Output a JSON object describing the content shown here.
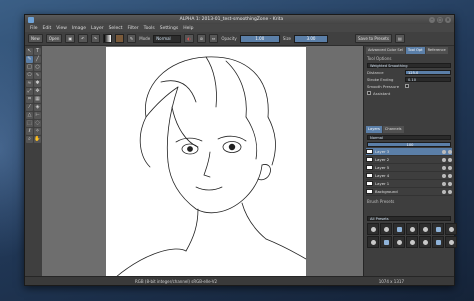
{
  "window": {
    "title": "ALPHA 1: 2013-01_test-smoothingZone - Krita"
  },
  "menu": [
    "File",
    "Edit",
    "View",
    "Image",
    "Layer",
    "Select",
    "Filter",
    "Tools",
    "Settings",
    "Help"
  ],
  "toolbar": {
    "new_label": "New",
    "open_label": "Open",
    "mode_label": "Mode",
    "blend_mode": "Normal",
    "opacity_label": "Opacity",
    "opacity_value": "1.00",
    "size_label": "Size",
    "size_value": "3.00",
    "save_preset_label": "Save to Presets"
  },
  "tool_options": {
    "header": "Tool Options",
    "smoothing_label": "Weighted Smoothing",
    "distance_label": "Distance",
    "distance_value": "125.0",
    "stroke_ending_label": "Stroke Ending",
    "stroke_ending_value": "0.10",
    "smooth_pressure_label": "Smooth Pressure",
    "assistant_label": "Assistant"
  },
  "dock_tabs_top": [
    "Advanced Color Sel",
    "Tool Opt",
    "Reference"
  ],
  "layers": {
    "tabs": [
      "Layers",
      "Channels"
    ],
    "blend_mode": "Normal",
    "opacity": "100",
    "items": [
      {
        "name": "Layer 3"
      },
      {
        "name": "Layer 2"
      },
      {
        "name": "Layer 5"
      },
      {
        "name": "Layer 4"
      },
      {
        "name": "Layer 1"
      },
      {
        "name": "Background"
      }
    ]
  },
  "brush_presets": {
    "header": "Brush Presets",
    "filter_label": "All Presets"
  },
  "status": {
    "left": "RGB (8-bit integer/channel)  sRGB-elle-V2",
    "right": "1074 x 1317"
  },
  "colors": {
    "accent": "#5b7fa8",
    "fg": "#000000",
    "bg": "#ffffff"
  }
}
